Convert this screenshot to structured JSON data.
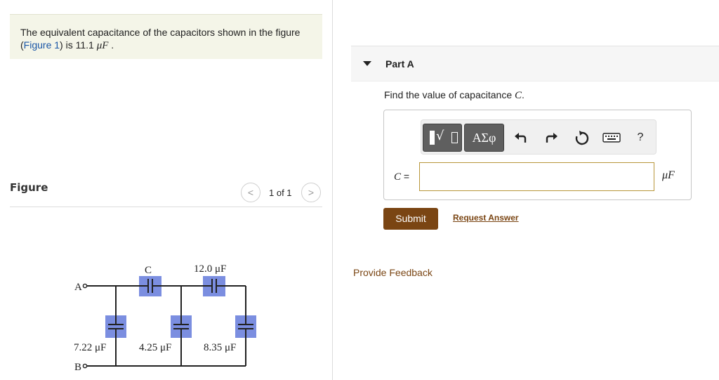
{
  "problem": {
    "text_before": "The equivalent capacitance of the capacitors shown in the figure",
    "link_open": "(",
    "link_text": "Figure 1",
    "link_close": ")",
    "text_after": " is 11.1 ",
    "unit": "μF",
    "period": " ."
  },
  "figure": {
    "label": "Figure",
    "pager": {
      "prev": "<",
      "text": "1 of 1",
      "next": ">"
    },
    "circuit": {
      "terminal_a": "A",
      "terminal_b": "B",
      "top_left_cap": "C",
      "top_right_cap": "12.0 μF",
      "left_cap": "7.22 μF",
      "middle_cap": "4.25 μF",
      "right_cap": "8.35 μF",
      "highlight_color": "#7b8ee0"
    }
  },
  "part": {
    "title": "Part A",
    "question_prefix": "Find the value of capacitance ",
    "question_var": "C",
    "question_suffix": ".",
    "toolbar": {
      "template_icon": "template-radical-icon",
      "greek": "ΑΣφ",
      "undo_icon": "undo-icon",
      "redo_icon": "redo-icon",
      "reset_icon": "reset-icon",
      "keyboard_icon": "keyboard-icon",
      "help": "?"
    },
    "answer_var": "C",
    "answer_eq": " =",
    "answer_value": "",
    "answer_unit": "μF",
    "submit": "Submit",
    "request": "Request Answer"
  },
  "feedback": "Provide Feedback",
  "colors": {
    "accent_brown": "#7a4513",
    "link_blue": "#1a56a6",
    "problem_bg": "#f4f5e8"
  }
}
